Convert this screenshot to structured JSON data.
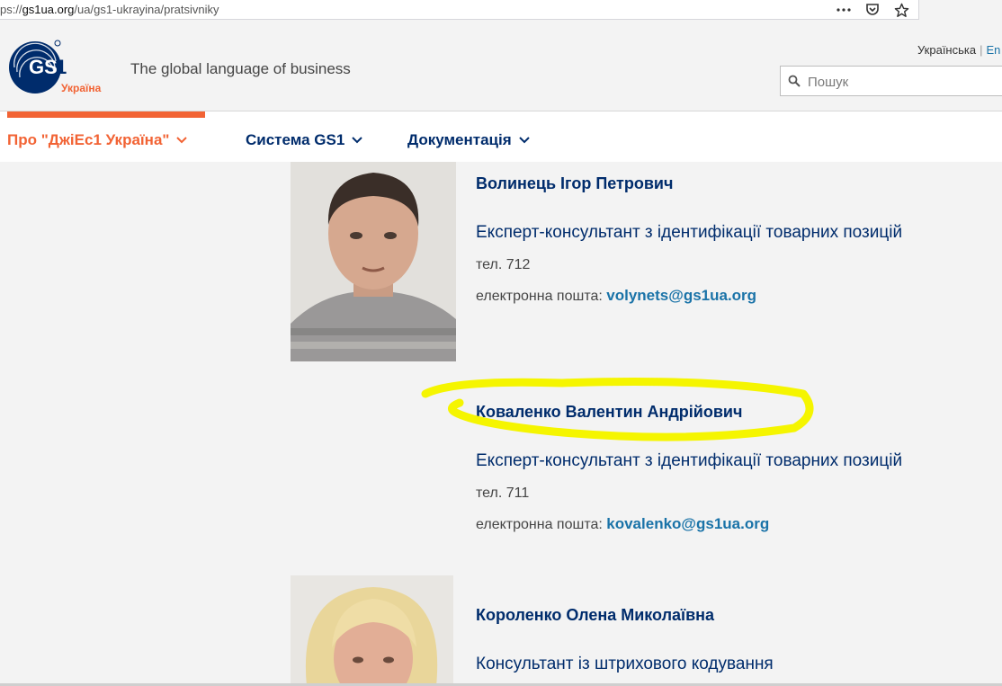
{
  "browser": {
    "url_prefix": "ps://",
    "url_host": "gs1ua.org",
    "url_path": "/ua/gs1-ukrayina/pratsivniky",
    "more_icon": "more-dots-icon",
    "pocket_icon": "pocket-icon",
    "bookmark_icon": "star-icon"
  },
  "header": {
    "logo_text": "GS1",
    "logo_sub": "Україна",
    "tagline": "The global language of business",
    "lang_current": "Українська",
    "lang_separator": "|",
    "lang_other": "En",
    "search_placeholder": "Пошук"
  },
  "nav": {
    "items": [
      {
        "label": "Про \"ДжіЕс1 Україна\"",
        "active": true
      },
      {
        "label": "Система GS1",
        "active": false
      },
      {
        "label": "Документація",
        "active": false
      }
    ]
  },
  "staff": [
    {
      "name": "Волинець Ігор Петрович",
      "role": "Експерт-консультант з ідентифікації товарних позицій",
      "tel": "тел. 712",
      "email_label": "електронна пошта:",
      "email": "volynets@gs1ua.org"
    },
    {
      "name": "Коваленко Валентин Андрійович",
      "role": "Експерт-консультант з ідентифікації товарних позицій",
      "tel": "тел. 711",
      "email_label": "електронна пошта:",
      "email": "kovalenko@gs1ua.org",
      "highlighted": true
    },
    {
      "name": "Короленко Олена Миколаївна",
      "role": "Консультант із штрихового кодування"
    }
  ],
  "colors": {
    "brand_navy": "#002c6c",
    "brand_orange": "#f26334",
    "link": "#1a73a8",
    "highlight": "#f5f500"
  }
}
